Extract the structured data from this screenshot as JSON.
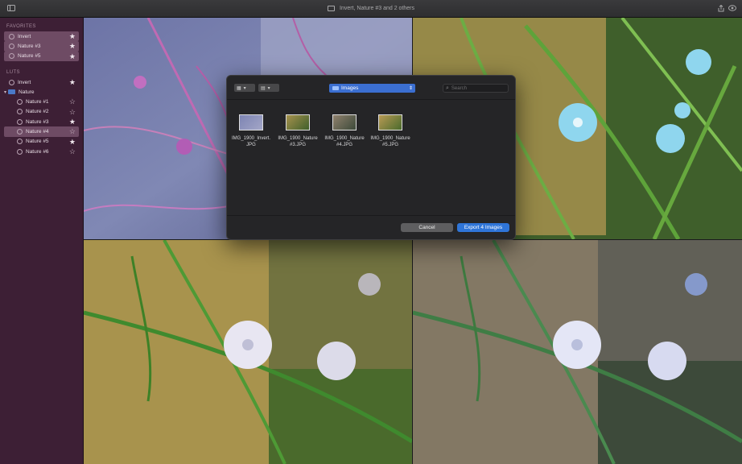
{
  "window": {
    "title": "Invert, Nature #3 and 2 others"
  },
  "sidebar": {
    "favorites_title": "FAVORITES",
    "favorites": [
      {
        "label": "Invert",
        "selected": true
      },
      {
        "label": "Nature #3",
        "selected": true
      },
      {
        "label": "Nature #5",
        "selected": true
      }
    ],
    "luts_title": "LUTS",
    "invert": {
      "label": "Invert",
      "starred": true
    },
    "folder": {
      "label": "Nature"
    },
    "folder_items": [
      {
        "label": "Nature #1",
        "starred": false,
        "selected": false
      },
      {
        "label": "Nature #2",
        "starred": false,
        "selected": false
      },
      {
        "label": "Nature #3",
        "starred": true,
        "selected": false
      },
      {
        "label": "Nature #4",
        "starred": false,
        "selected": true
      },
      {
        "label": "Nature #5",
        "starred": true,
        "selected": false
      },
      {
        "label": "Nature #6",
        "starred": false,
        "selected": false
      }
    ]
  },
  "dialog": {
    "location": "Images",
    "search_placeholder": "Search",
    "files": [
      {
        "name_line1": "IMG_1900_Invert.",
        "name_line2": "JPG"
      },
      {
        "name_line1": "IMG_1900_Nature",
        "name_line2": "#3.JPG"
      },
      {
        "name_line1": "IMG_1900_Nature",
        "name_line2": "#4.JPG"
      },
      {
        "name_line1": "IMG_1900_Nature",
        "name_line2": "#5.JPG"
      }
    ],
    "cancel_label": "Cancel",
    "export_label": "Export 4 Images"
  },
  "colors": {
    "sidebar_bg": "#3d1f35",
    "accent": "#2f75d8",
    "selected_row": "#6e4b64"
  },
  "icons": [
    "sidebar-toggle-icon",
    "window-icon",
    "share-icon",
    "eye-icon",
    "star-icon",
    "folder-icon",
    "search-icon",
    "grid-view-icon",
    "list-view-icon"
  ]
}
